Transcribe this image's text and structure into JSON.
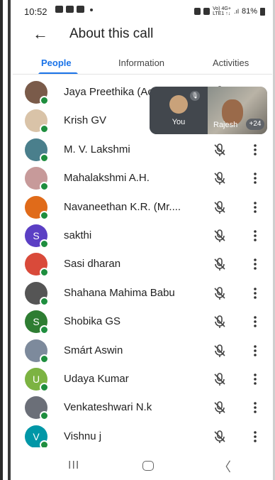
{
  "status": {
    "time": "10:52",
    "network_label": "Vo) 4G+\nLTE1 ↑↓",
    "battery": "81%"
  },
  "header": {
    "title": "About this call",
    "back_icon": "arrow-left-icon"
  },
  "tabs": [
    {
      "label": "People",
      "active": true
    },
    {
      "label": "Information",
      "active": false
    },
    {
      "label": "Activities",
      "active": false
    }
  ],
  "participants": [
    {
      "name": "Jaya Preethika (Act...",
      "avatar_color": "#7a5b4a",
      "letter": ""
    },
    {
      "name": "Krish GV",
      "avatar_color": "#d9c3a8",
      "letter": ""
    },
    {
      "name": "M. V. Lakshmi",
      "avatar_color": "#4a7f8c",
      "letter": ""
    },
    {
      "name": "Mahalakshmi A.H.",
      "avatar_color": "#c79a9a",
      "letter": ""
    },
    {
      "name": "Navaneethan K.R. (Mr....",
      "avatar_color": "#e06b1a",
      "letter": ""
    },
    {
      "name": "sakthi",
      "avatar_color": "#5b3fc4",
      "letter": "S"
    },
    {
      "name": "Sasi dharan",
      "avatar_color": "#d94a3a",
      "letter": ""
    },
    {
      "name": "Shahana Mahima Babu",
      "avatar_color": "#555555",
      "letter": ""
    },
    {
      "name": "Shobika GS",
      "avatar_color": "#2e7d32",
      "letter": "S"
    },
    {
      "name": "Smárt Aswin",
      "avatar_color": "#7d8a9c",
      "letter": ""
    },
    {
      "name": "Udaya Kumar",
      "avatar_color": "#7cb342",
      "letter": "U"
    },
    {
      "name": "Venkateshwari N.k",
      "avatar_color": "#6b6f78",
      "letter": ""
    },
    {
      "name": "Vishnu j",
      "avatar_color": "#0097a7",
      "letter": "V"
    }
  ],
  "overlay": {
    "you_label": "You",
    "other_label": "Rajesh",
    "count_badge": "+24"
  },
  "colors": {
    "accent": "#1a73e8",
    "online": "#1e8e3e"
  }
}
